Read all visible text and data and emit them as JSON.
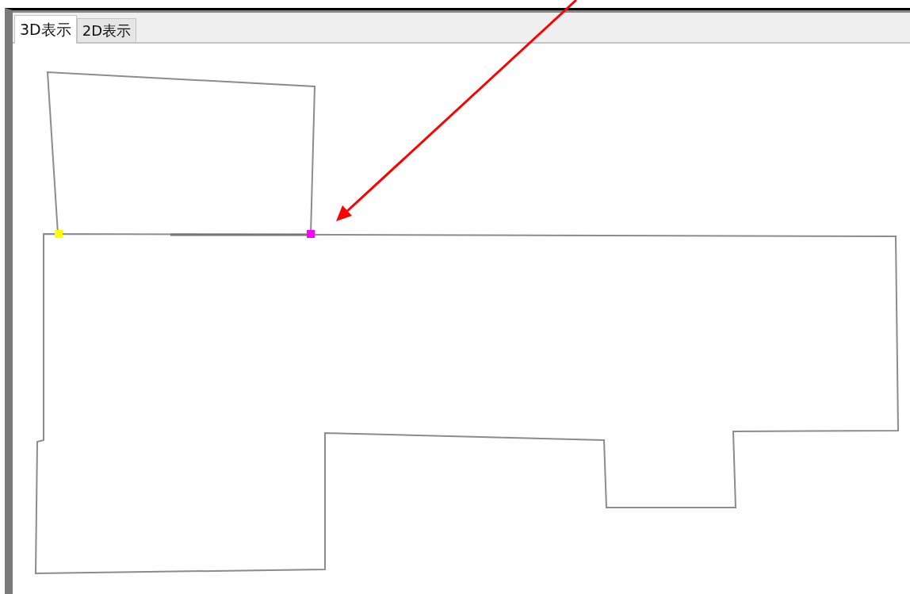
{
  "tabs": [
    {
      "label": "3D表示",
      "selected": true
    },
    {
      "label": "2D表示",
      "selected": false
    }
  ],
  "vertices": [
    {
      "color": "#ffff00"
    },
    {
      "color": "#ff00ff"
    }
  ]
}
